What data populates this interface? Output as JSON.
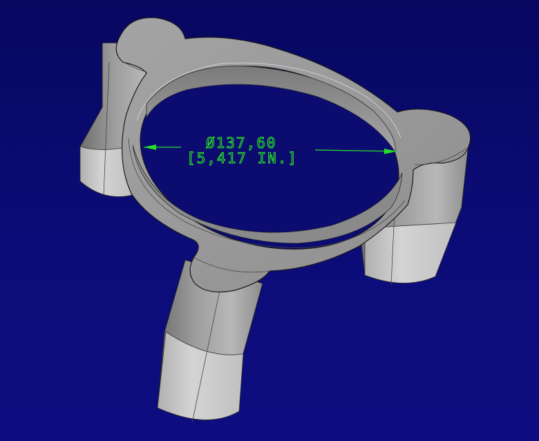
{
  "viewport": {
    "background": "#0a0a6a",
    "part_color": "#9a9a9a",
    "dimension_color": "#28e028"
  },
  "dimension": {
    "primary": "Ø137,60",
    "secondary": "[5,417 IN.]"
  }
}
